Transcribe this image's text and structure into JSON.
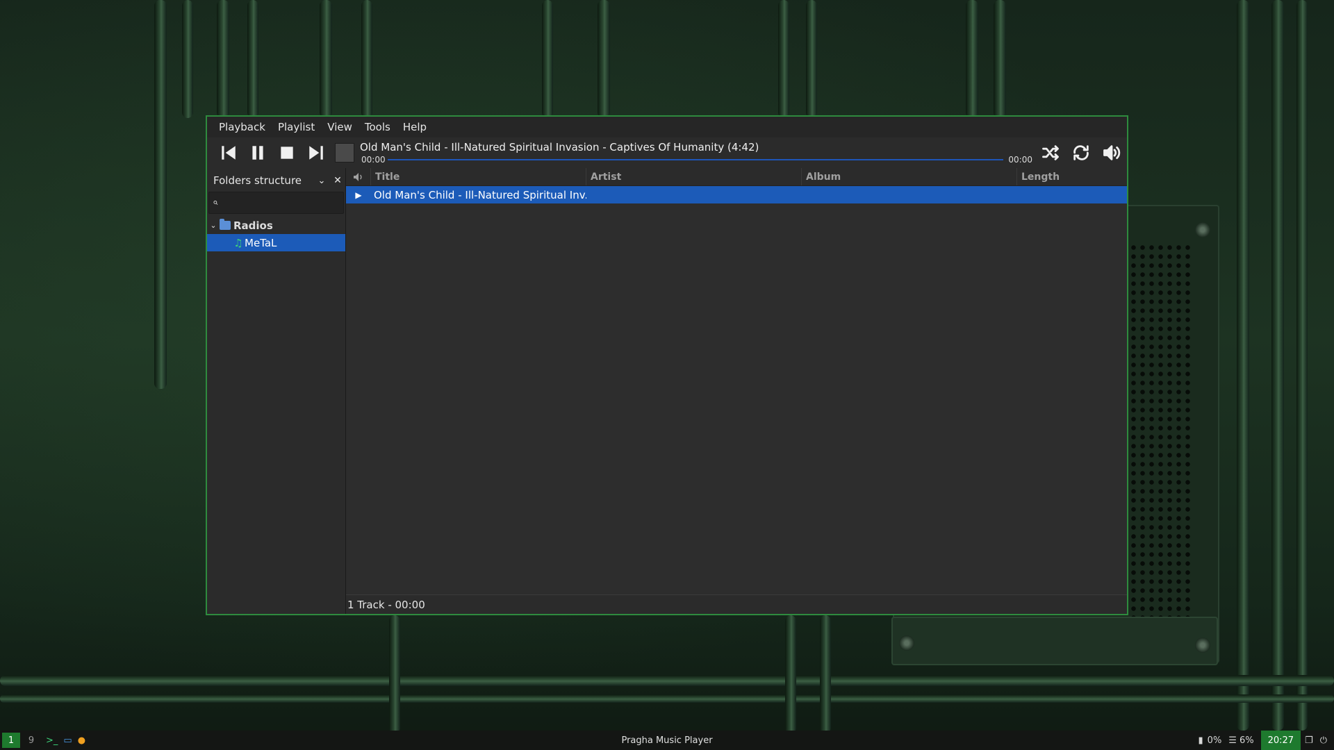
{
  "window": {
    "menu": [
      "Playback",
      "Playlist",
      "View",
      "Tools",
      "Help"
    ],
    "now_playing": "Old Man's Child - Ill-Natured Spiritual Invasion - Captives Of Humanity (4:42)",
    "time_elapsed": "00:00",
    "time_remaining": "00:00",
    "progress_fraction": 0.0
  },
  "sidebar": {
    "title": "Folders structure",
    "search_placeholder": "",
    "tree": [
      {
        "label": "Radios",
        "type": "folder",
        "expanded": true
      },
      {
        "label": "MeTaL",
        "type": "track",
        "selected": true
      }
    ]
  },
  "playlist": {
    "columns": [
      "Title",
      "Artist",
      "Album",
      "Length"
    ],
    "rows": [
      {
        "title": "Old Man's Child - Ill-Natured Spiritual Inv...",
        "artist": "",
        "album": "",
        "length": "",
        "playing": true
      }
    ],
    "status": "1 Track - 00:00"
  },
  "taskbar": {
    "workspaces": [
      "1",
      "9"
    ],
    "title": "Pragha Music Player",
    "battery": "0%",
    "memory": "6%",
    "clock": "20:27"
  },
  "colors": {
    "accent": "#1c5bb8",
    "window_border": "#2e8b3e",
    "taskbar_accent": "#1e7a2e"
  }
}
